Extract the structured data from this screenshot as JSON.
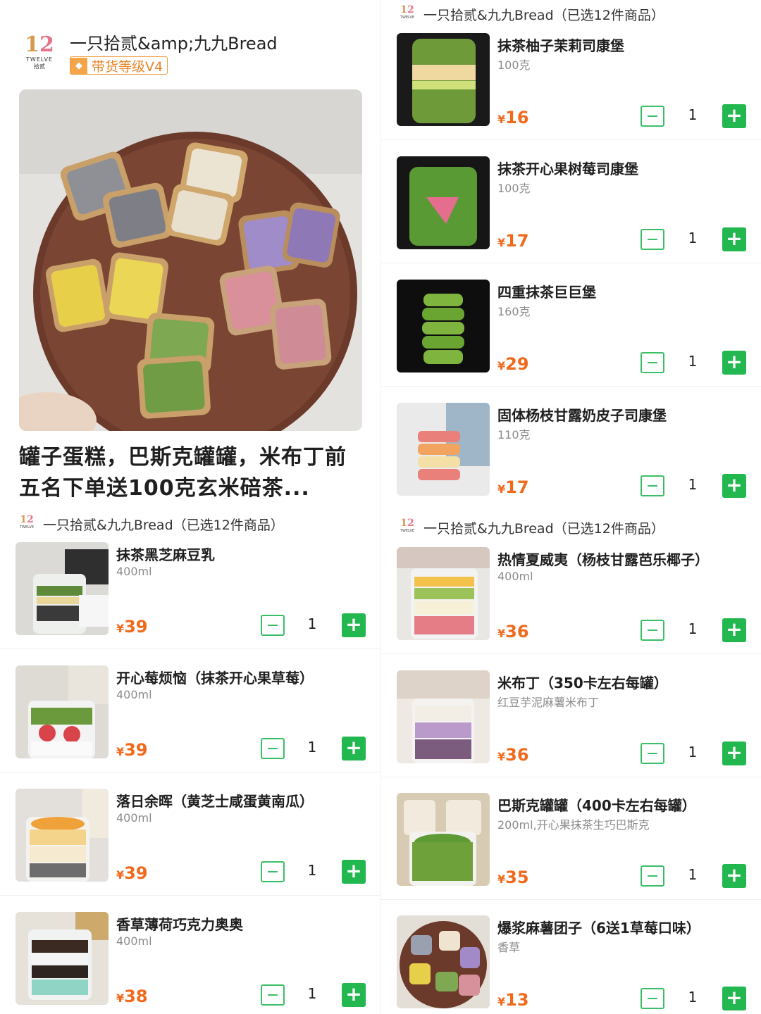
{
  "left": {
    "logo": {
      "num_a": "1",
      "num_b": "2",
      "word": "TWELVE",
      "cn": "拾贰"
    },
    "shop_name": "一只拾贰&amp;九九Bread",
    "badge": "带货等级V4",
    "title": "罐子蛋糕，巴斯克罐罐，米布丁前五名下单送100克玄米碚茶...",
    "shop_row": "一只拾贰&九九Bread（已选12件商品）",
    "products": [
      {
        "name": "抹茶黑芝麻豆乳",
        "spec": "400ml",
        "currency": "¥",
        "price": "39",
        "qty": "1"
      },
      {
        "name": "开心莓烦恼（抹茶开心果草莓）",
        "spec": "400ml",
        "currency": "¥",
        "price": "39",
        "qty": "1"
      },
      {
        "name": "落日余晖（黄芝士咸蛋黄南瓜）",
        "spec": "400ml",
        "currency": "¥",
        "price": "39",
        "qty": "1"
      },
      {
        "name": "香草薄荷巧克力奥奥",
        "spec": "400ml",
        "currency": "¥",
        "price": "38",
        "qty": "1"
      }
    ]
  },
  "right": {
    "shop_row_1": "一只拾贰&九九Bread（已选12件商品）",
    "products_1": [
      {
        "name": "抹茶柚子茉莉司康堡",
        "spec": "100克",
        "currency": "¥",
        "price": "16",
        "qty": "1"
      },
      {
        "name": "抹茶开心果树莓司康堡",
        "spec": "100克",
        "currency": "¥",
        "price": "17",
        "qty": "1"
      },
      {
        "name": "四重抹茶巨巨堡",
        "spec": "160克",
        "currency": "¥",
        "price": "29",
        "qty": "1"
      },
      {
        "name": "固体杨枝甘露奶皮子司康堡",
        "spec": "110克",
        "currency": "¥",
        "price": "17",
        "qty": "1"
      }
    ],
    "shop_row_2": "一只拾贰&九九Bread（已选12件商品）",
    "products_2": [
      {
        "name": "热情夏威夷（杨枝甘露芭乐椰子）",
        "spec": "400ml",
        "currency": "¥",
        "price": "36",
        "qty": "1"
      },
      {
        "name": "米布丁（350卡左右每罐）",
        "spec": "红豆芋泥麻薯米布丁",
        "currency": "¥",
        "price": "36",
        "qty": "1"
      },
      {
        "name": "巴斯克罐罐（400卡左右每罐）",
        "spec": "200ml,开心果抹茶生巧巴斯克",
        "currency": "¥",
        "price": "35",
        "qty": "1"
      },
      {
        "name": "爆浆麻薯团子（6送1草莓口味）",
        "spec": "香草",
        "currency": "¥",
        "price": "13",
        "qty": "1"
      }
    ]
  },
  "colors": {
    "price": "#f06a1d",
    "green": "#22b84f",
    "badge": "#f09a3e"
  },
  "icons": [
    "diamond-icon",
    "minus-icon",
    "plus-icon"
  ]
}
